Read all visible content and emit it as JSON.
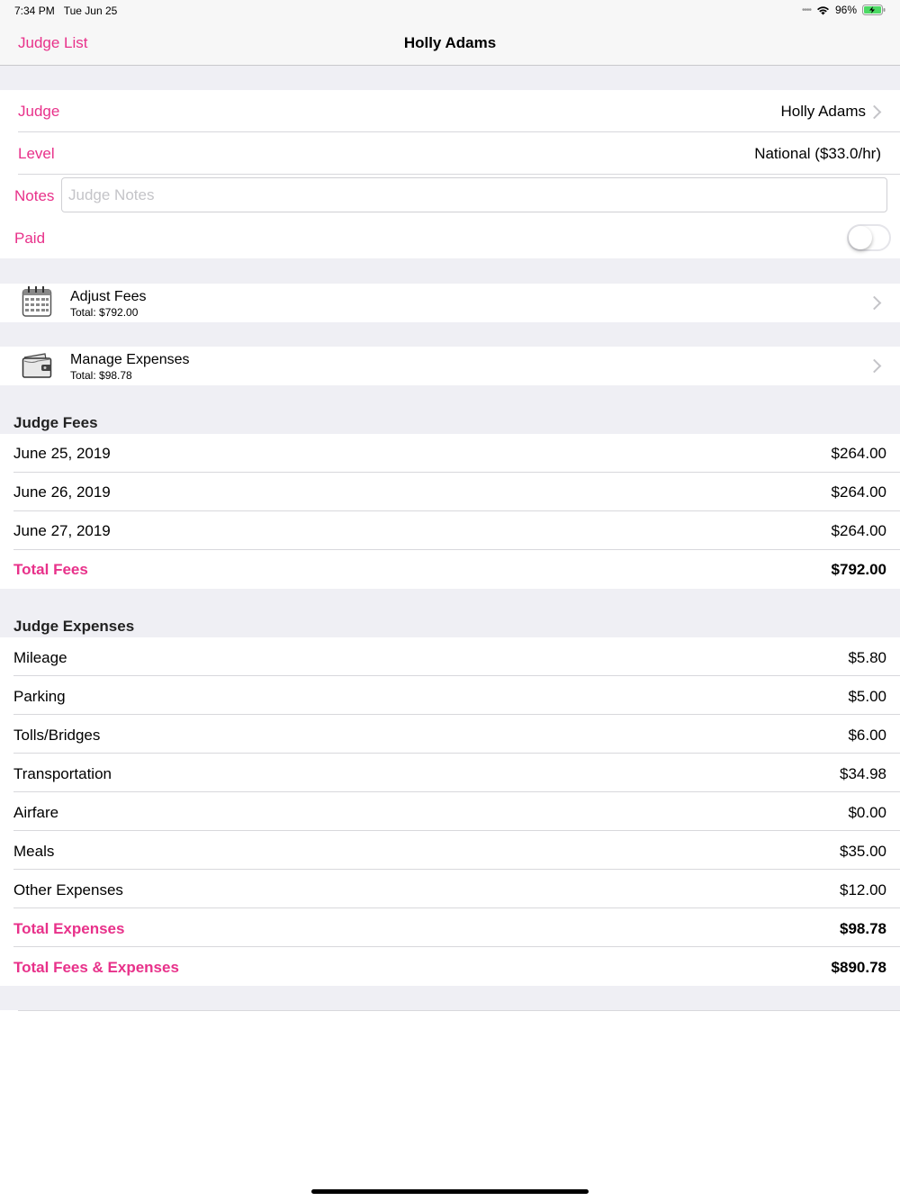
{
  "status_bar": {
    "time": "7:34 PM",
    "date": "Tue Jun 25",
    "battery": "96%",
    "icons": [
      "signal-dots-icon",
      "wifi-icon",
      "battery-charging-icon"
    ]
  },
  "nav": {
    "back_label": "Judge List",
    "title": "Holly Adams"
  },
  "form": {
    "judge_label": "Judge",
    "judge_value": "Holly Adams",
    "level_label": "Level",
    "level_value": "National ($33.0/hr)",
    "notes_label": "Notes",
    "notes_placeholder": "Judge Notes",
    "notes_value": "",
    "paid_label": "Paid",
    "paid_on": false
  },
  "actions": [
    {
      "title": "Adjust Fees",
      "subtitle": "Total: $792.00",
      "icon": "calendar-icon"
    },
    {
      "title": "Manage Expenses",
      "subtitle": "Total: $98.78",
      "icon": "wallet-icon"
    }
  ],
  "fees": {
    "header": "Judge Fees",
    "rows": [
      {
        "label": "June 25, 2019",
        "value": "$264.00"
      },
      {
        "label": "June 26, 2019",
        "value": "$264.00"
      },
      {
        "label": "June 27, 2019",
        "value": "$264.00"
      }
    ],
    "total_label": "Total Fees",
    "total_value": "$792.00"
  },
  "expenses": {
    "header": "Judge Expenses",
    "rows": [
      {
        "label": "Mileage",
        "value": "$5.80"
      },
      {
        "label": "Parking",
        "value": "$5.00"
      },
      {
        "label": "Tolls/Bridges",
        "value": "$6.00"
      },
      {
        "label": "Transportation",
        "value": "$34.98"
      },
      {
        "label": "Airfare",
        "value": "$0.00"
      },
      {
        "label": "Meals",
        "value": "$35.00"
      },
      {
        "label": "Other Expenses",
        "value": "$12.00"
      }
    ],
    "total_label": "Total Expenses",
    "total_value": "$98.78",
    "grand_total_label": "Total Fees & Expenses",
    "grand_total_value": "$890.78"
  },
  "colors": {
    "accent": "#E8318A",
    "group_background": "#EFEFF4",
    "separator": "#D8D8DC"
  }
}
